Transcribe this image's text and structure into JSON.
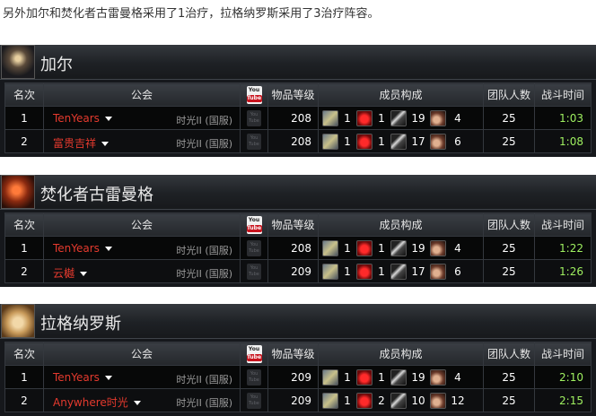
{
  "intro_text": "另外加尔和焚化者古雷曼格采用了1治疗，拉格纳罗斯采用了3治疗阵容。",
  "columns": {
    "rank": "名次",
    "guild": "公会",
    "video": "YouTube",
    "item_level": "物品等级",
    "composition": "成员构成",
    "raid_size": "团队人数",
    "fight_time": "战斗时间"
  },
  "youtube_icon": {
    "top": "You",
    "bottom": "Tube"
  },
  "bosses": [
    {
      "name": "加尔",
      "icon": "garr-portrait",
      "rows": [
        {
          "rank": "1",
          "guild": "TenYears",
          "realm": "时光II (国服)",
          "item_level": "208",
          "tank": "1",
          "heal": "1",
          "mdps": "19",
          "rdps": "4",
          "raid_size": "25",
          "time": "1:03"
        },
        {
          "rank": "2",
          "guild": "富贵吉祥",
          "realm": "时光II (国服)",
          "item_level": "208",
          "tank": "1",
          "heal": "1",
          "mdps": "17",
          "rdps": "6",
          "raid_size": "25",
          "time": "1:08"
        }
      ]
    },
    {
      "name": "焚化者古雷曼格",
      "icon": "golemagg-portrait",
      "rows": [
        {
          "rank": "1",
          "guild": "TenYears",
          "realm": "时光II (国服)",
          "item_level": "208",
          "tank": "1",
          "heal": "1",
          "mdps": "19",
          "rdps": "4",
          "raid_size": "25",
          "time": "1:22"
        },
        {
          "rank": "2",
          "guild": "云樾",
          "realm": "时光II (国服)",
          "item_level": "209",
          "tank": "1",
          "heal": "1",
          "mdps": "17",
          "rdps": "6",
          "raid_size": "25",
          "time": "1:26"
        }
      ]
    },
    {
      "name": "拉格纳罗斯",
      "icon": "ragnaros-portrait",
      "rows": [
        {
          "rank": "1",
          "guild": "TenYears",
          "realm": "时光II (国服)",
          "item_level": "209",
          "tank": "1",
          "heal": "1",
          "mdps": "19",
          "rdps": "4",
          "raid_size": "25",
          "time": "2:10"
        },
        {
          "rank": "2",
          "guild": "Anywhere时光",
          "realm": "时光II (国服)",
          "item_level": "209",
          "tank": "1",
          "heal": "2",
          "mdps": "10",
          "rdps": "12",
          "raid_size": "25",
          "time": "2:15"
        }
      ]
    }
  ],
  "colors": {
    "panel_bg": "#16181c",
    "guild_name": "#e53a2e",
    "rank_1": "#f0c400",
    "rank_2": "#e0325a",
    "fight_time": "#9ff060",
    "realm": "#9a9a9a"
  }
}
